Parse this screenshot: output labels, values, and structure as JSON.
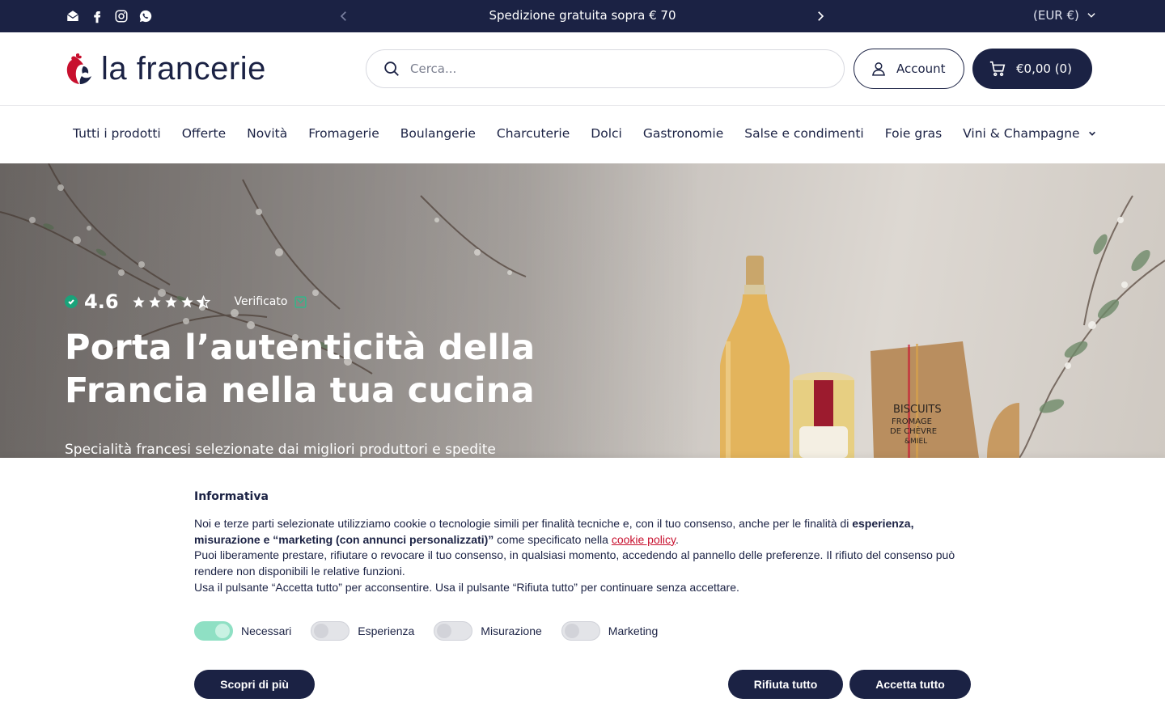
{
  "topbar": {
    "socials": [
      "email-icon",
      "facebook-icon",
      "instagram-icon",
      "whatsapp-icon"
    ],
    "promo": "Spedizione gratuita sopra € 70",
    "currency": "(EUR €)"
  },
  "header": {
    "logo_text": "la francerie",
    "search_placeholder": "Cerca...",
    "account_label": "Account",
    "cart_label": "€0,00 (0)"
  },
  "nav": {
    "items": [
      "Tutti i prodotti",
      "Offerte",
      "Novità",
      "Fromagerie",
      "Boulangerie",
      "Charcuterie",
      "Dolci",
      "Gastronomie",
      "Salse e condimenti",
      "Foie gras",
      "Vini & Champagne"
    ]
  },
  "hero": {
    "rating": "4.6",
    "stars": 4.5,
    "verified": "Verificato",
    "title": "Porta l’autenticità della Francia nella tua cucina",
    "subtitle": "Specialità francesi selezionate dai migliori produttori e spedite",
    "product_label_1": "BISCUITS",
    "product_label_2": "FROMAGE",
    "product_label_3": "DE CHÈVRE",
    "product_label_4": "&MIEL"
  },
  "cookie": {
    "title": "Informativa",
    "p1_a": "Noi e terze parti selezionate utilizziamo cookie o tecnologie simili per finalità tecniche e, con il tuo consenso, anche per le finalità di ",
    "p1_b": "esperienza, misurazione e “marketing (con annunci personalizzati)”",
    "p1_c": " come specificato nella ",
    "p1_link": "cookie policy",
    "p1_d": ".",
    "p2": "Puoi liberamente prestare, rifiutare o revocare il tuo consenso, in qualsiasi momento, accedendo al pannello delle preferenze. Il rifiuto del consenso può rendere non disponibili le relative funzioni.",
    "p3": "Usa il pulsante “Accetta tutto” per acconsentire. Usa il pulsante “Rifiuta tutto” per continuare senza accettare.",
    "toggles": [
      {
        "label": "Necessari",
        "on": true
      },
      {
        "label": "Esperienza",
        "on": false
      },
      {
        "label": "Misurazione",
        "on": false
      },
      {
        "label": "Marketing",
        "on": false
      }
    ],
    "btn_more": "Scopri di più",
    "btn_reject": "Rifiuta tutto",
    "btn_accept": "Accetta tutto"
  },
  "colors": {
    "navy": "#1b2244",
    "accent_red": "#c8102e",
    "toggle_on": "#8fe0c4",
    "trust_green": "#1aa37a"
  }
}
